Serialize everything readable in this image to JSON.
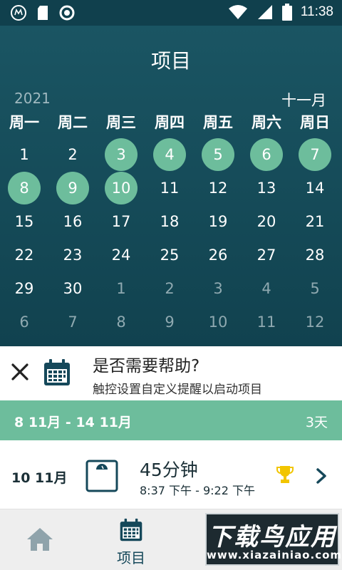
{
  "status_bar": {
    "time": "11:38",
    "icons": [
      "motorola-icon",
      "sd-card-icon",
      "sync-circle-icon",
      "wifi-icon",
      "signal-icon",
      "battery-icon"
    ]
  },
  "calendar": {
    "title": "项目",
    "year": "2021",
    "month": "十一月",
    "weekdays": [
      "周一",
      "周二",
      "周三",
      "周四",
      "周五",
      "周六",
      "周日"
    ],
    "weeks": [
      [
        {
          "d": "1"
        },
        {
          "d": "2"
        },
        {
          "d": "3",
          "m": true
        },
        {
          "d": "4",
          "m": true
        },
        {
          "d": "5",
          "m": true
        },
        {
          "d": "6",
          "m": true
        },
        {
          "d": "7",
          "m": true
        }
      ],
      [
        {
          "d": "8",
          "m": true
        },
        {
          "d": "9",
          "m": true
        },
        {
          "d": "10",
          "m": true
        },
        {
          "d": "11"
        },
        {
          "d": "12"
        },
        {
          "d": "13"
        },
        {
          "d": "14"
        }
      ],
      [
        {
          "d": "15"
        },
        {
          "d": "16"
        },
        {
          "d": "17"
        },
        {
          "d": "18"
        },
        {
          "d": "19"
        },
        {
          "d": "20"
        },
        {
          "d": "21"
        }
      ],
      [
        {
          "d": "22"
        },
        {
          "d": "23"
        },
        {
          "d": "24"
        },
        {
          "d": "25"
        },
        {
          "d": "26"
        },
        {
          "d": "27"
        },
        {
          "d": "28"
        }
      ],
      [
        {
          "d": "29"
        },
        {
          "d": "30"
        },
        {
          "d": "1",
          "o": true
        },
        {
          "d": "2",
          "o": true
        },
        {
          "d": "3",
          "o": true
        },
        {
          "d": "4",
          "o": true
        },
        {
          "d": "5",
          "o": true
        }
      ],
      [
        {
          "d": "6",
          "o": true
        },
        {
          "d": "7",
          "o": true
        },
        {
          "d": "8",
          "o": true
        },
        {
          "d": "9",
          "o": true
        },
        {
          "d": "10",
          "o": true
        },
        {
          "d": "11",
          "o": true
        },
        {
          "d": "12",
          "o": true
        }
      ]
    ],
    "colors": {
      "marked": "#6dbd9c",
      "header_bg": "#1a5563"
    }
  },
  "help_banner": {
    "title": "是否需要帮助?",
    "subtitle": "触控设置自定义提醒以启动项目"
  },
  "week_range": {
    "label": "8 11月 - 14 11月",
    "days": "3天"
  },
  "session": {
    "date": "10 11月",
    "duration": "45分钟",
    "time_range": "8:37 下午 - 9:22 下午",
    "trophy_color": "#f2c500"
  },
  "nav": {
    "projects_label": "项目"
  },
  "watermark": {
    "main": "下载鸟应用",
    "url": "www.xiazainiao.com"
  }
}
